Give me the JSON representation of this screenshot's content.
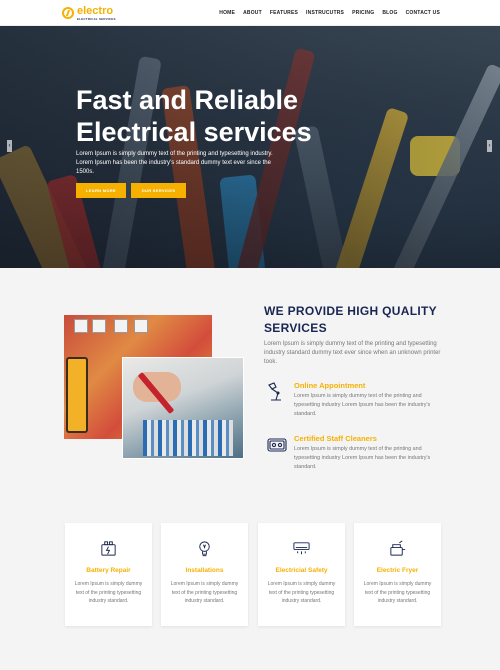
{
  "header": {
    "logo_name": "electro",
    "logo_tagline": "ELECTRICAL SERVICES",
    "nav": [
      "HOME",
      "ABOUT",
      "FEATURES",
      "INSTRUCUTRS",
      "PRICING",
      "BLOG",
      "CONTACT US"
    ]
  },
  "hero": {
    "title": "Fast and Reliable Electrical services",
    "description": "Lorem Ipsum is simply dummy text of the printing and typesetting industry. Lorem Ipsum has been the industry's standard dummy text ever since the 1500s.",
    "btn_learn": "LEARN MORE",
    "btn_services": "OUR SERVICES",
    "arrow_left": "‹",
    "arrow_right": "›"
  },
  "intro": {
    "title": "WE PROVIDE HIGH QUALITY SERVICES",
    "description": "Lorem Ipsum is simply dummy text of the printing and typesetting industry standard dummy text ever since when an unknown printer took.",
    "features": [
      {
        "title": "Online Appointment",
        "description": "Lorem Ipsum is simply dummy text of the printing and typesetting industry Lorem Ipsum has been the industry's standard.",
        "icon": "desk-lamp-icon"
      },
      {
        "title": "Certified Staff Cleaners",
        "description": "Lorem Ipsum is simply dummy text of the printing and typesetting industry Lorem Ipsum has been the industry's standard.",
        "icon": "socket-icon"
      }
    ]
  },
  "cards": [
    {
      "title": "Battery Repair",
      "description": "Lorem Ipsum is simply dummy text of the printing typesetting industry standard.",
      "icon": "battery-icon"
    },
    {
      "title": "Installations",
      "description": "Lorem Ipsum is simply dummy text of the printing typesetting industry standard.",
      "icon": "bulb-icon"
    },
    {
      "title": "Electricial Safety",
      "description": "Lorem Ipsum is simply dummy text of the printing typesetting industry standard.",
      "icon": "air-conditioner-icon"
    },
    {
      "title": "Electric Fryer",
      "description": "Lorem Ipsum is simply dummy text of the printing typesetting industry standard.",
      "icon": "fryer-icon"
    }
  ],
  "colors": {
    "accent": "#f6b100",
    "navy": "#1a2652"
  }
}
